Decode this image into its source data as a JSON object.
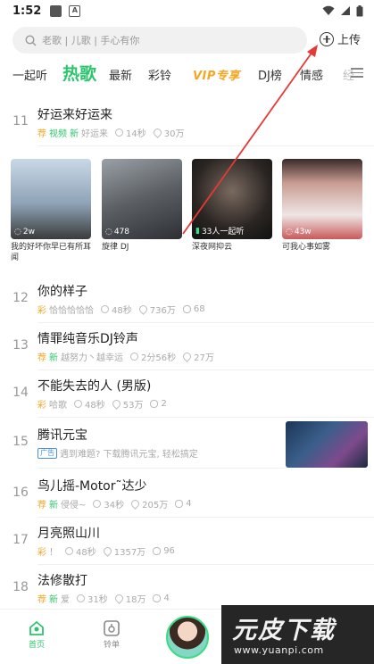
{
  "status_bar": {
    "time": "1:52",
    "a_label": "A"
  },
  "search": {
    "placeholder": "老歌 | 儿歌 | 手心有你"
  },
  "upload": {
    "label": "上传"
  },
  "tabs": [
    {
      "label": "一起听"
    },
    {
      "label": "热歌"
    },
    {
      "label": "最新"
    },
    {
      "label": "彩铃"
    },
    {
      "label": "VIP专享"
    },
    {
      "label": "DJ榜"
    },
    {
      "label": "情感"
    },
    {
      "label": "经"
    }
  ],
  "songs": [
    {
      "num": "11",
      "title": "好运来好运来",
      "tags": [
        "荐",
        "视频",
        "新"
      ],
      "artist": "好运来",
      "duration": "14秒",
      "plays": "30万",
      "comments": ""
    },
    {
      "num": "12",
      "title": "你的样子",
      "tags": [
        "彩"
      ],
      "artist": "恰恰恰恰恰",
      "duration": "48秒",
      "plays": "736万",
      "comments": "68"
    },
    {
      "num": "13",
      "title": "情罪纯音乐DJ铃声",
      "tags": [
        "荐",
        "新"
      ],
      "artist": "越努力丶越幸运",
      "duration": "2分56秒",
      "plays": "27万",
      "comments": ""
    },
    {
      "num": "14",
      "title": "不能失去的人 (男版)",
      "tags": [
        "彩"
      ],
      "artist": "哈歌",
      "duration": "48秒",
      "plays": "53万",
      "comments": "2"
    },
    {
      "num": "16",
      "title": "鸟儿摇-Motor˜达少",
      "tags": [
        "荐",
        "新"
      ],
      "artist": "侵侵~",
      "duration": "34秒",
      "plays": "205万",
      "comments": "4"
    },
    {
      "num": "17",
      "title": "月亮照山川",
      "tags": [
        "彩"
      ],
      "artist": "！",
      "duration": "48秒",
      "plays": "1357万",
      "comments": "96"
    },
    {
      "num": "18",
      "title": "法修散打",
      "tags": [
        "荐",
        "新"
      ],
      "artist": "爱",
      "duration": "31秒",
      "plays": "18万",
      "comments": "4"
    }
  ],
  "ad": {
    "num": "15",
    "title": "腾讯元宝",
    "tag": "广告",
    "desc": "遇到难题? 下载腾讯元宝, 轻松搞定"
  },
  "cards": [
    {
      "count": "2w",
      "caption": "我的好坏你早已有所耳闻",
      "icon": "headphones-icon",
      "bg": "#9fb3c8"
    },
    {
      "count": "478",
      "caption": "旋律 DJ",
      "icon": "headphones-icon",
      "bg": "#6b6f75"
    },
    {
      "count": "33人一起听",
      "caption": "深夜网抑云",
      "icon": "equalizer-icon",
      "bg": "#2b2b2b"
    },
    {
      "count": "43w",
      "caption": "可我心事如雾",
      "icon": "headphones-icon",
      "bg": "#d9b9b9"
    }
  ],
  "bottom_nav": [
    {
      "label": "首页",
      "icon": "home-icon"
    },
    {
      "label": "铃单",
      "icon": "ringtone-list-icon"
    }
  ],
  "watermark": {
    "title": "元皮下载",
    "url": "www.yuanpi.com"
  },
  "colors": {
    "accent": "#2ec46e",
    "vip": "#f5a623",
    "annotation_arrow": "#e53935"
  }
}
